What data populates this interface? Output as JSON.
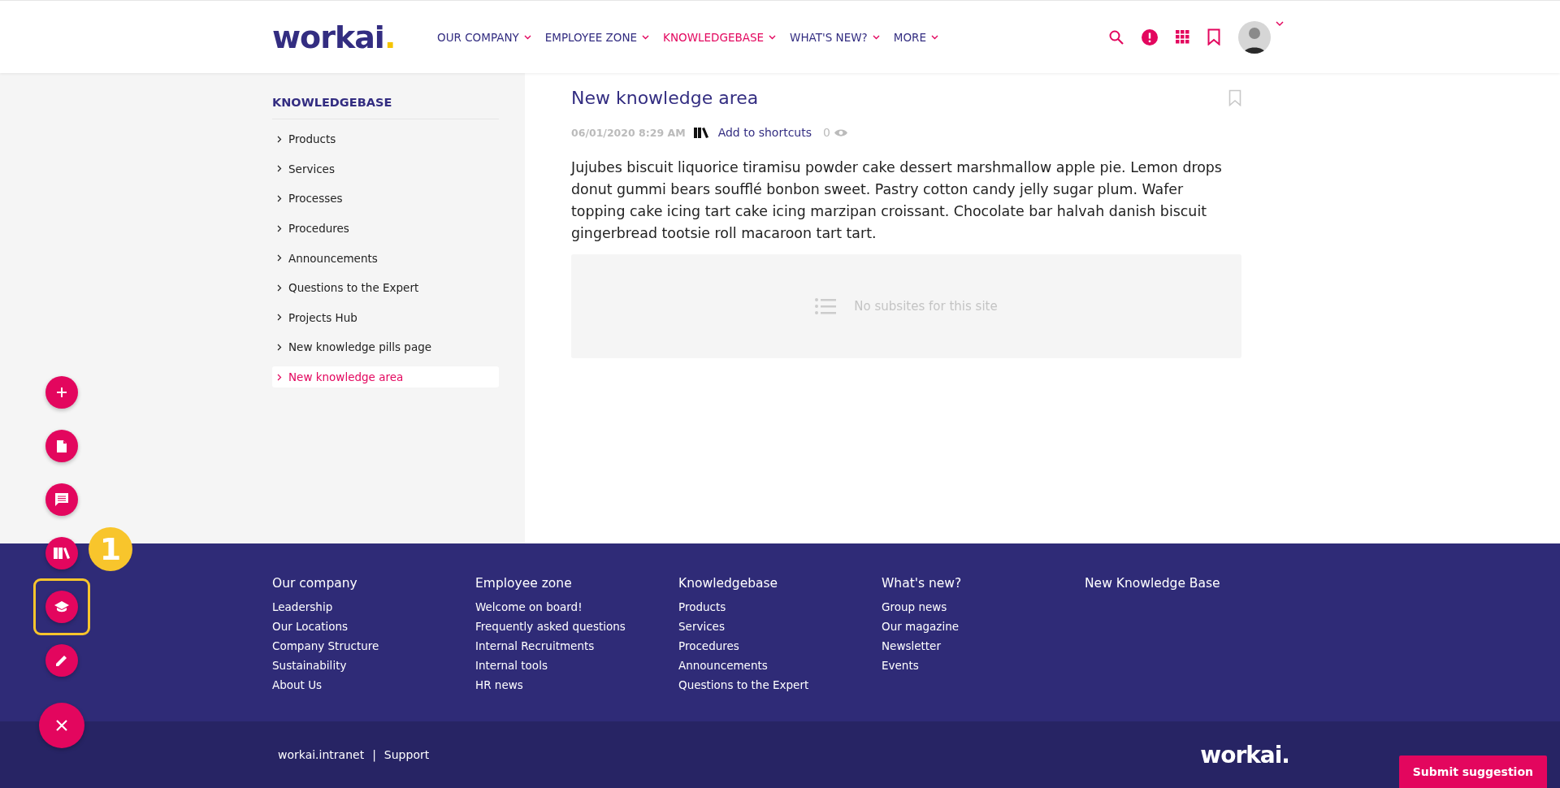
{
  "header": {
    "logo": {
      "name": "workai",
      "dot": "."
    },
    "nav": [
      {
        "label": "OUR COMPANY",
        "selected": false
      },
      {
        "label": "EMPLOYEE ZONE",
        "selected": false
      },
      {
        "label": "KNOWLEDGEBASE",
        "selected": true
      },
      {
        "label": "WHAT'S NEW?",
        "selected": false
      },
      {
        "label": "MORE",
        "selected": false
      }
    ]
  },
  "sidebar": {
    "title": "KNOWLEDGEBASE",
    "items": [
      {
        "label": "Products",
        "selected": false
      },
      {
        "label": "Services",
        "selected": false
      },
      {
        "label": "Processes",
        "selected": false
      },
      {
        "label": "Procedures",
        "selected": false
      },
      {
        "label": "Announcements",
        "selected": false
      },
      {
        "label": "Questions to the Expert",
        "selected": false
      },
      {
        "label": "Projects Hub",
        "selected": false
      },
      {
        "label": "New knowledge pills page",
        "selected": false
      },
      {
        "label": "New knowledge area",
        "selected": true
      }
    ]
  },
  "page": {
    "title": "New knowledge area",
    "date": "06/01/2020 8:29 AM",
    "shortcut_link": "Add to shortcuts",
    "views": "0",
    "body": "Jujubes biscuit liquorice tiramisu powder cake dessert marshmallow apple pie. Lemon drops donut gummi bears soufflé bonbon sweet. Pastry cotton candy jelly sugar plum. Wafer topping cake icing tart cake icing marzipan croissant. Chocolate bar halvah danish biscuit gingerbread tootsie roll macaroon tart tart.",
    "empty_message": "No subsites for this site"
  },
  "action_buttons": [
    {
      "kind": "plus",
      "highlighted": false
    },
    {
      "kind": "document",
      "highlighted": false
    },
    {
      "kind": "comment",
      "highlighted": false
    },
    {
      "kind": "books",
      "highlighted": false
    },
    {
      "kind": "graduation",
      "highlighted": true
    },
    {
      "kind": "pencil",
      "highlighted": false
    },
    {
      "kind": "close",
      "highlighted": false
    }
  ],
  "callout_badge": "1",
  "footer": {
    "columns": [
      {
        "title": "Our company",
        "links": [
          "Leadership",
          "Our Locations",
          "Company Structure",
          "Sustainability",
          "About Us"
        ]
      },
      {
        "title": "Employee zone",
        "links": [
          "Welcome on board!",
          "Frequently asked questions",
          "Internal Recruitments",
          "Internal tools",
          "HR news"
        ]
      },
      {
        "title": "Knowledgebase",
        "links": [
          "Products",
          "Services",
          "Procedures",
          "Announcements",
          "Questions to the Expert"
        ]
      },
      {
        "title": "What's new?",
        "links": [
          "Group news",
          "Our magazine",
          "Newsletter",
          "Events"
        ]
      },
      {
        "title": "New Knowledge Base"
      }
    ],
    "bottom_links": [
      "workai.intranet",
      "Support"
    ],
    "separator": "|",
    "logo": {
      "name": "workai",
      "dot": "."
    }
  },
  "submit_button": "Submit suggestion"
}
